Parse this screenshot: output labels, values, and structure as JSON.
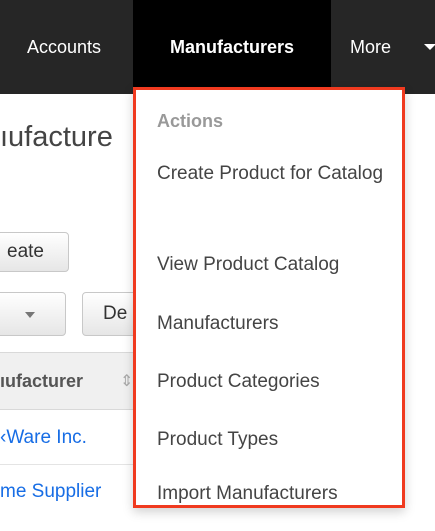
{
  "navbar": {
    "items": [
      {
        "label": "Accounts"
      },
      {
        "label": "Manufacturers"
      },
      {
        "label": "More"
      }
    ]
  },
  "page": {
    "title_partial": "ıufacture",
    "create_button_partial": "eate",
    "delete_button_partial": "De",
    "column_header_partial": "ıufacturer",
    "rows": [
      {
        "name_partial": "‹Ware Inc."
      },
      {
        "name_partial": "me Supplier"
      }
    ]
  },
  "dropdown": {
    "heading": "Actions",
    "items": [
      {
        "label": "Create Product for Catalog"
      },
      {
        "label": "View Product Catalog"
      },
      {
        "label": "Manufacturers"
      },
      {
        "label": "Product Categories"
      },
      {
        "label": "Product Types"
      },
      {
        "label": "Import Manufacturers"
      }
    ]
  },
  "colors": {
    "navbar_bg": "#262626",
    "active_tab_bg": "#000000",
    "highlight_border": "#f03a1f",
    "link": "#176de5"
  },
  "icons": {
    "more_caret": "caret-down-icon",
    "sort": "sort-icon",
    "select_caret": "chevron-down-icon"
  }
}
